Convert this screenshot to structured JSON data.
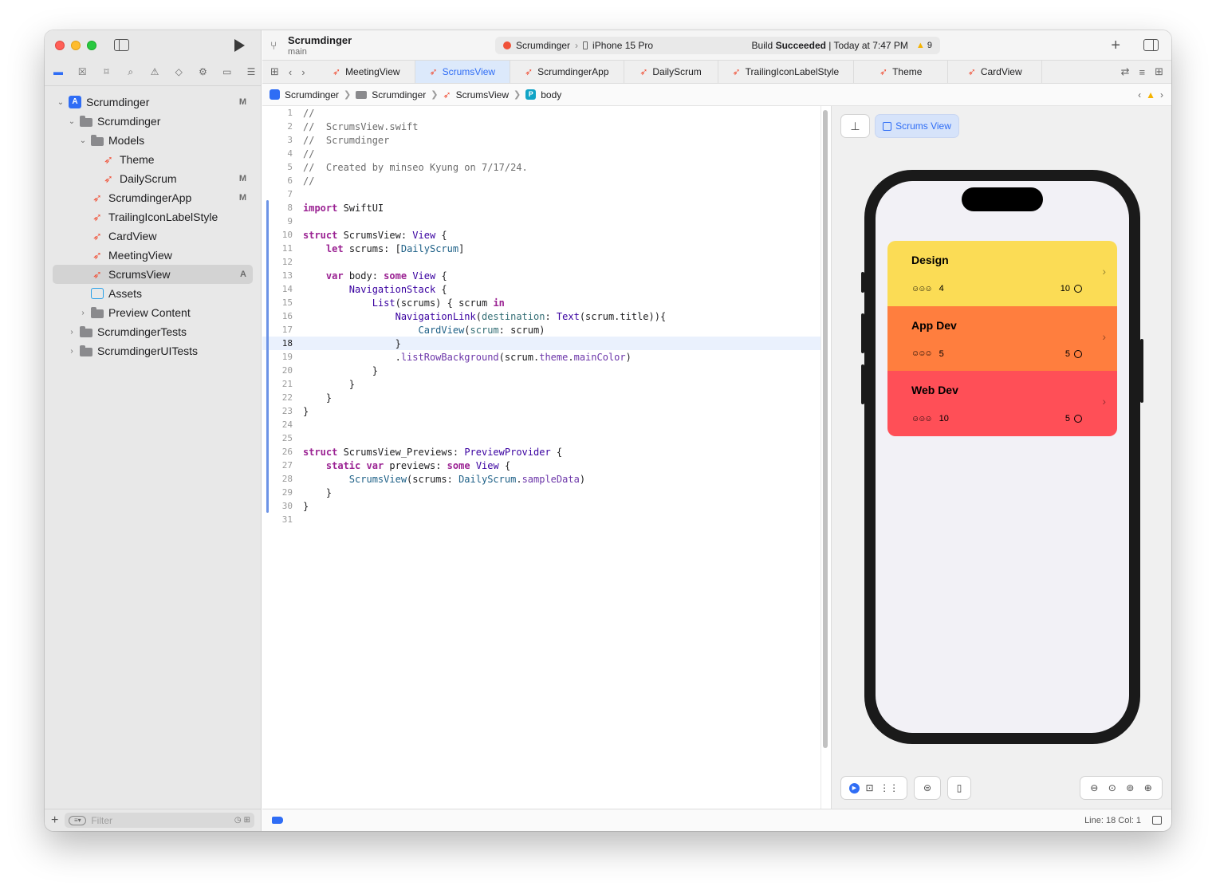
{
  "window": {
    "project_name": "Scrumdinger",
    "branch": "main"
  },
  "toolbar": {
    "scheme": "Scrumdinger",
    "device": "iPhone 15 Pro",
    "status_prefix": "Build",
    "status_bold": "Succeeded",
    "status_time": "| Today at 7:47 PM",
    "warning_count": "9",
    "add_label": "+"
  },
  "sidebar": {
    "tree": [
      {
        "label": "Scrumdinger",
        "badge": "M",
        "kind": "project",
        "chev": "v",
        "indent": 0
      },
      {
        "label": "Scrumdinger",
        "badge": "",
        "kind": "folder",
        "chev": "v",
        "indent": 1
      },
      {
        "label": "Models",
        "badge": "",
        "kind": "folder",
        "chev": "v",
        "indent": 2
      },
      {
        "label": "Theme",
        "badge": "",
        "kind": "swift",
        "chev": "",
        "indent": 3
      },
      {
        "label": "DailyScrum",
        "badge": "M",
        "kind": "swift",
        "chev": "",
        "indent": 3
      },
      {
        "label": "ScrumdingerApp",
        "badge": "M",
        "kind": "swift",
        "chev": "",
        "indent": 2
      },
      {
        "label": "TrailingIconLabelStyle",
        "badge": "",
        "kind": "swift",
        "chev": "",
        "indent": 2
      },
      {
        "label": "CardView",
        "badge": "",
        "kind": "swift",
        "chev": "",
        "indent": 2
      },
      {
        "label": "MeetingView",
        "badge": "",
        "kind": "swift",
        "chev": "",
        "indent": 2
      },
      {
        "label": "ScrumsView",
        "badge": "A",
        "kind": "swift",
        "chev": "",
        "indent": 2,
        "selected": true
      },
      {
        "label": "Assets",
        "badge": "",
        "kind": "assets",
        "chev": "",
        "indent": 2
      },
      {
        "label": "Preview Content",
        "badge": "",
        "kind": "folder",
        "chev": ">",
        "indent": 2
      },
      {
        "label": "ScrumdingerTests",
        "badge": "",
        "kind": "folder",
        "chev": ">",
        "indent": 1
      },
      {
        "label": "ScrumdingerUITests",
        "badge": "",
        "kind": "folder",
        "chev": ">",
        "indent": 1
      }
    ],
    "filter_placeholder": "Filter"
  },
  "tabs": [
    {
      "label": "MeetingView",
      "active": false
    },
    {
      "label": "ScrumsView",
      "active": true
    },
    {
      "label": "ScrumdingerApp",
      "active": false
    },
    {
      "label": "DailyScrum",
      "active": false
    },
    {
      "label": "TrailingIconLabelStyle",
      "active": false
    },
    {
      "label": "Theme",
      "active": false
    },
    {
      "label": "CardView",
      "active": false
    }
  ],
  "breadcrumb": {
    "project": "Scrumdinger",
    "folder": "Scrumdinger",
    "file": "ScrumsView",
    "symbol": "body"
  },
  "code": {
    "current_line": 18,
    "lines": [
      "//",
      "//  ScrumsView.swift",
      "//  Scrumdinger",
      "//",
      "//  Created by minseo Kyung on 7/17/24.",
      "//",
      "",
      "import SwiftUI",
      "",
      "struct ScrumsView: View {",
      "    let scrums: [DailyScrum]",
      "",
      "    var body: some View {",
      "        NavigationStack {",
      "            List(scrums) { scrum in",
      "                NavigationLink(destination: Text(scrum.title)){",
      "                    CardView(scrum: scrum)",
      "                }",
      "                .listRowBackground(scrum.theme.mainColor)",
      "            }",
      "        }",
      "    }",
      "}",
      "",
      "",
      "struct ScrumsView_Previews: PreviewProvider {",
      "    static var previews: some View {",
      "        ScrumsView(scrums: DailyScrum.sampleData)",
      "    }",
      "}",
      ""
    ]
  },
  "preview": {
    "chip_label": "Scrums View",
    "cards": [
      {
        "title": "Design",
        "attendees": "4",
        "duration": "10",
        "color": "#fbdc55"
      },
      {
        "title": "App Dev",
        "attendees": "5",
        "duration": "5",
        "color": "#ff7e3e"
      },
      {
        "title": "Web Dev",
        "attendees": "10",
        "duration": "5",
        "color": "#ff4f57"
      }
    ]
  },
  "statusbar": {
    "line_col": "Line: 18  Col: 1"
  },
  "colors": {
    "accent": "#2f6df5",
    "swift_orange": "#f05138",
    "warning": "#f5b301"
  }
}
